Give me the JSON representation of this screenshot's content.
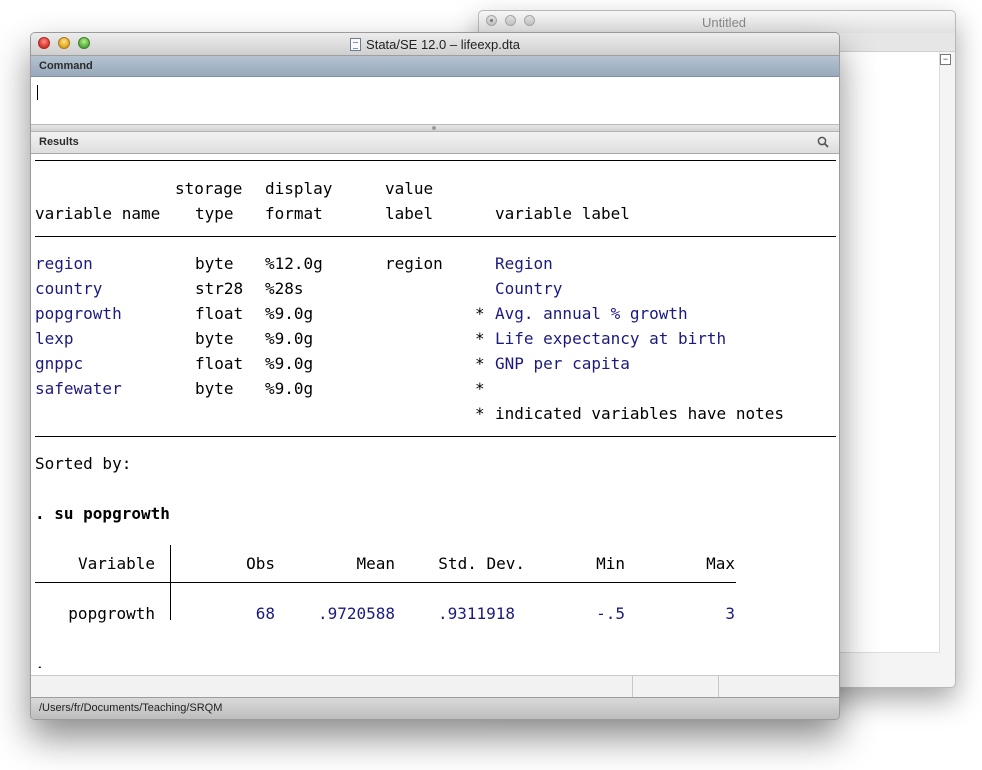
{
  "background_window": {
    "title": "Untitled"
  },
  "window": {
    "title": "Stata/SE 12.0 – lifeexp.dta"
  },
  "command_panel": {
    "label": "Command",
    "value": ""
  },
  "results_panel": {
    "label": "Results"
  },
  "describe": {
    "header1": {
      "storage": "storage",
      "display": "display",
      "value": "value"
    },
    "header2": {
      "varname": "variable name",
      "type": "type",
      "format": "format",
      "vlabel": "label",
      "varlabel": "variable label"
    },
    "rows": [
      {
        "name": "region",
        "type": "byte",
        "format": "%12.0g",
        "vlabel": "region",
        "note": "",
        "label": "Region"
      },
      {
        "name": "country",
        "type": "str28",
        "format": "%28s",
        "vlabel": "",
        "note": "",
        "label": "Country"
      },
      {
        "name": "popgrowth",
        "type": "float",
        "format": "%9.0g",
        "vlabel": "",
        "note": "*",
        "label": "Avg. annual % growth"
      },
      {
        "name": "lexp",
        "type": "byte",
        "format": "%9.0g",
        "vlabel": "",
        "note": "*",
        "label": "Life expectancy at birth"
      },
      {
        "name": "gnppc",
        "type": "float",
        "format": "%9.0g",
        "vlabel": "",
        "note": "*",
        "label": "GNP per capita"
      },
      {
        "name": "safewater",
        "type": "byte",
        "format": "%9.0g",
        "vlabel": "",
        "note": "*",
        "label": ""
      }
    ],
    "notes_star": "*",
    "notes_text": "indicated variables have notes",
    "sorted_by": "Sorted by:"
  },
  "command_echo": ". su popgrowth",
  "summary": {
    "headers": {
      "variable": "Variable",
      "obs": "Obs",
      "mean": "Mean",
      "sd": "Std. Dev.",
      "min": "Min",
      "max": "Max"
    },
    "row": {
      "variable": "popgrowth",
      "obs": "68",
      "mean": ".9720588",
      "sd": ".9311918",
      "min": "-.5",
      "max": "3"
    }
  },
  "prompt": ".",
  "status_bar": {
    "path": "/Users/fr/Documents/Teaching/SRQM"
  },
  "colors": {
    "result_blue": "#1a1a80",
    "command_header": "#a7b7c8"
  },
  "icons": {
    "search": "magnifier-icon",
    "document": "document-icon"
  }
}
